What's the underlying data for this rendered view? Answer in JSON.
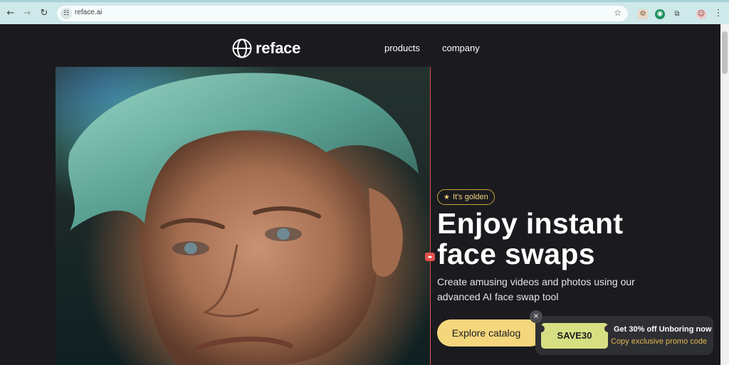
{
  "browser": {
    "url": "reface.ai",
    "back_icon": "←",
    "forward_icon": "→",
    "reload_icon": "↻",
    "site_info_icon": "☷",
    "star_icon": "☆",
    "menu_icon": "⋮",
    "extensions": [
      "⚙",
      "◉",
      "⧉",
      "☺"
    ]
  },
  "nav": {
    "logo_text": "reface",
    "links": [
      "products",
      "company"
    ]
  },
  "hero": {
    "badge": "It's golden",
    "headline_line1": "Enjoy instant",
    "headline_line2": "face swaps",
    "subhead": "Create amusing videos and photos using our advanced AI face swap tool",
    "cta": "Explore catalog",
    "slider_handle": "◂▸"
  },
  "promo": {
    "code": "SAVE30",
    "title": "Get 30% off Unboring now",
    "subtitle": "Copy exclusive promo code",
    "close": "×"
  },
  "colors": {
    "accent": "#f4d77c",
    "divider": "#d9534f",
    "background": "#1b1b1f"
  }
}
